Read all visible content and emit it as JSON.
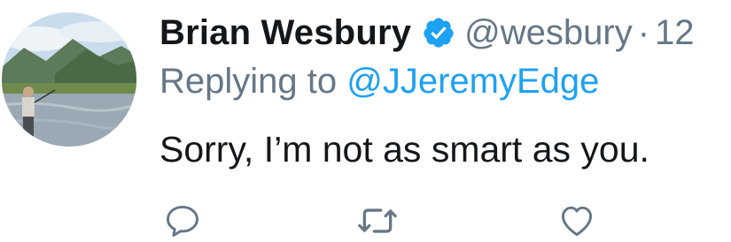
{
  "tweet": {
    "display_name": "Brian Wesbury",
    "handle": "@wesbury",
    "separator": "·",
    "time": "12",
    "reply_prefix": "Replying to ",
    "reply_mention": "@JJeremyEdge",
    "text": "Sorry, I’m not as smart as you.",
    "verified": true
  },
  "actions": {
    "reply_icon": "reply-icon",
    "retweet_icon": "retweet-icon",
    "like_icon": "like-icon"
  },
  "colors": {
    "name": "#14171a",
    "secondary": "#657786",
    "link": "#1da1f2",
    "verified_badge": "#1da1f2"
  }
}
